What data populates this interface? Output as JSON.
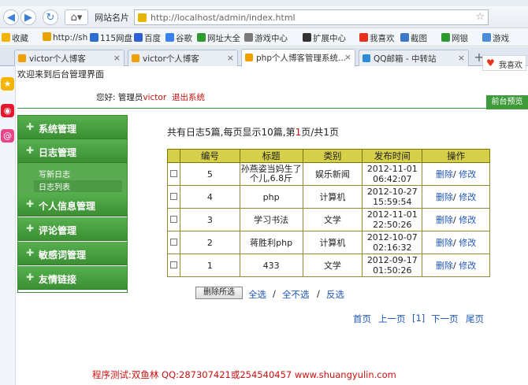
{
  "browser": {
    "site_name_menu": "网站名片",
    "url": "http://localhost/admin/index.html",
    "bookmarks": [
      "收藏",
      "http://sh",
      "115网盘",
      "百度",
      "谷歌",
      "网址大全",
      "游戏中心",
      "扩展中心",
      "我喜欢",
      "截图",
      "网银",
      "游戏"
    ],
    "tabs": [
      "victor个人博客",
      "victor个人博客",
      "php个人博客管理系统...",
      "QQ邮箱 - 中转站"
    ],
    "like_label": "我喜欢"
  },
  "page": {
    "welcome": "欢迎来到后台管理界面",
    "greeting_prefix": "您好:",
    "user_role": "管理员",
    "user_name": "victor",
    "logout": "退出系统",
    "frontend_preview": "前台预览",
    "menu": [
      "系统管理",
      "日志管理",
      "个人信息管理",
      "评论管理",
      "敏感词管理",
      "友情链接"
    ],
    "submenu": [
      "写新日志",
      "日志列表"
    ],
    "summary": {
      "prefix": "共有日志",
      "total": "5",
      "mid1": "篇,每页显示",
      "per_page": "10",
      "mid2": "篇,第",
      "page": "1",
      "mid3": "页/共",
      "pages": "1",
      "suffix": "页"
    },
    "table": {
      "headers": [
        "编号",
        "标题",
        "类别",
        "发布时间",
        "操作"
      ],
      "rows": [
        {
          "id": "5",
          "title": "孙燕姿当妈生了个儿,6.8斤",
          "category": "娱乐新闻",
          "date": "2012-11-01",
          "time": "06:42:07"
        },
        {
          "id": "4",
          "title": "php",
          "category": "计算机",
          "date": "2012-10-27",
          "time": "15:59:54"
        },
        {
          "id": "3",
          "title": "学习书法",
          "category": "文学",
          "date": "2012-11-01",
          "time": "22:50:26"
        },
        {
          "id": "2",
          "title": "蒋胜利php",
          "category": "计算机",
          "date": "2012-10-07",
          "time": "02:16:32"
        },
        {
          "id": "1",
          "title": "433",
          "category": "文学",
          "date": "2012-09-17",
          "time": "01:50:26"
        }
      ],
      "delete_label": "删除",
      "edit_label": "修改"
    },
    "delete_selected": "删除所选",
    "select_all": "全选",
    "select_none": "全不选",
    "invert": "反选",
    "pager": {
      "first": "首页",
      "prev": "上一页",
      "current": "[1]",
      "next": "下一页",
      "last": "尾页"
    },
    "footer": "程序测试:双鱼林 QQ:287307421或254540457  www.shuangyulin.com"
  },
  "colors": {
    "menu_green": "#3f9a3a",
    "table_header": "#d6cf4a",
    "link_blue": "#2056b8",
    "accent_red": "#cc1010"
  }
}
